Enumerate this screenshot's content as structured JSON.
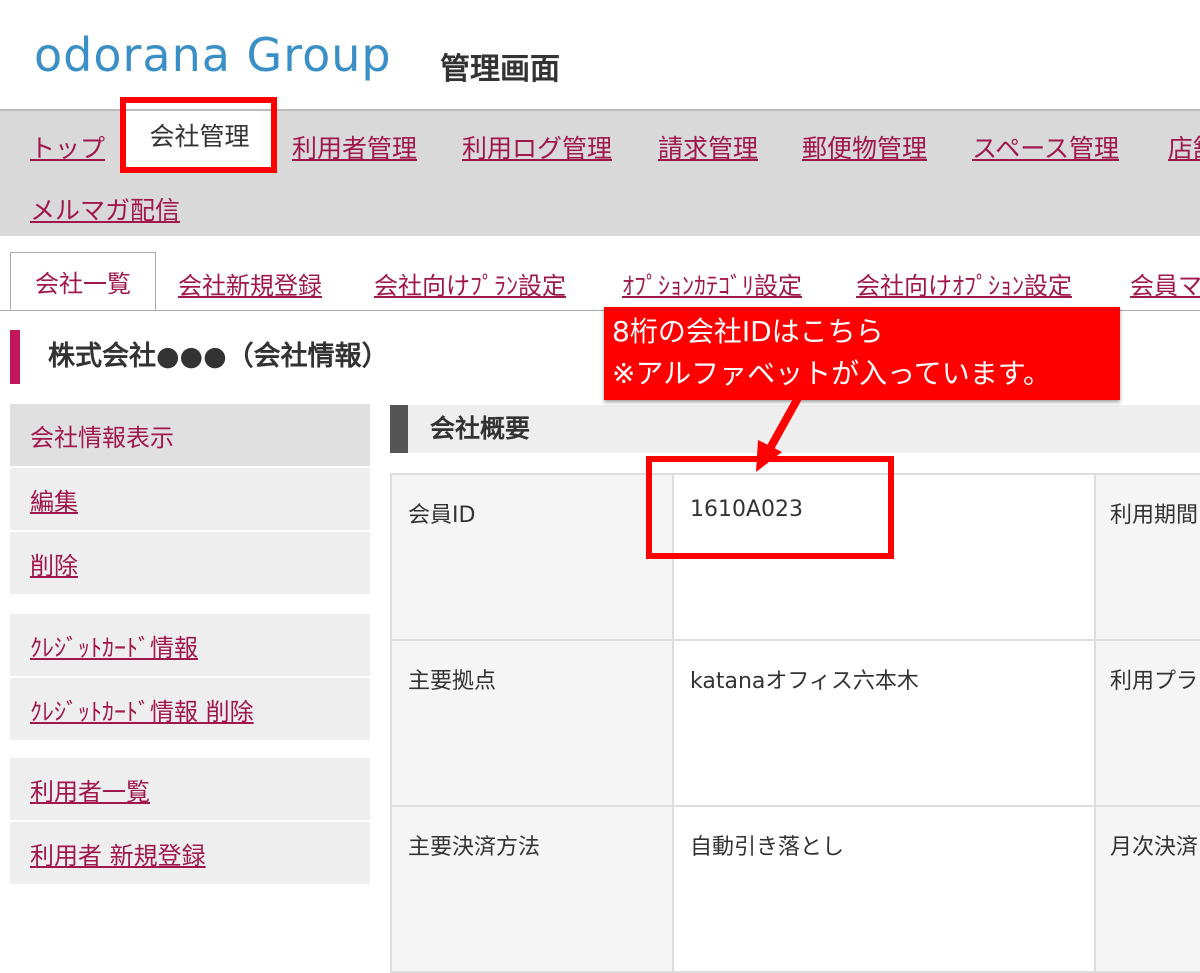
{
  "header": {
    "logo": "odorana Group",
    "admin_title": "管理画面"
  },
  "nav": {
    "items": [
      "トップ",
      "会社管理",
      "利用者管理",
      "利用ログ管理",
      "請求管理",
      "郵便物管理",
      "スペース管理",
      "店舗",
      "メルマガ配信"
    ],
    "active": "会社管理"
  },
  "subtabs": {
    "items": [
      "会社一覧",
      "会社新規登録",
      "会社向けﾌﾟﾗﾝ設定",
      "ｵﾌﾟｼｮﾝｶﾃｺﾞﾘ設定",
      "会社向けｵﾌﾟｼｮﾝ設定",
      "会員マス"
    ]
  },
  "company_title": "株式会社●●●（会社情報）",
  "sidebar": {
    "group1": [
      "会社情報表示",
      "編集",
      "削除"
    ],
    "group2": [
      "ｸﾚｼﾞｯﾄｶｰﾄﾞ情報",
      "ｸﾚｼﾞｯﾄｶｰﾄﾞ情報 削除"
    ],
    "group3": [
      "利用者一覧",
      "利用者 新規登録"
    ]
  },
  "section": {
    "title": "会社概要",
    "rows": [
      {
        "label": "会員ID",
        "value": "1610A023",
        "label2": "利用期間"
      },
      {
        "label": "主要拠点",
        "value": "katanaオフィス六本木",
        "label2": "利用プラ"
      },
      {
        "label": "主要決済方法",
        "value": "自動引き落とし",
        "label2": "月次決済"
      }
    ]
  },
  "callout": {
    "line1": "8桁の会社IDはこちら",
    "line2": "※アルファベットが入っています。",
    "color": "#ff0000"
  },
  "colors": {
    "accent": "#a0174c",
    "logo": "#3a8fc6",
    "highlight": "#ff0000"
  }
}
